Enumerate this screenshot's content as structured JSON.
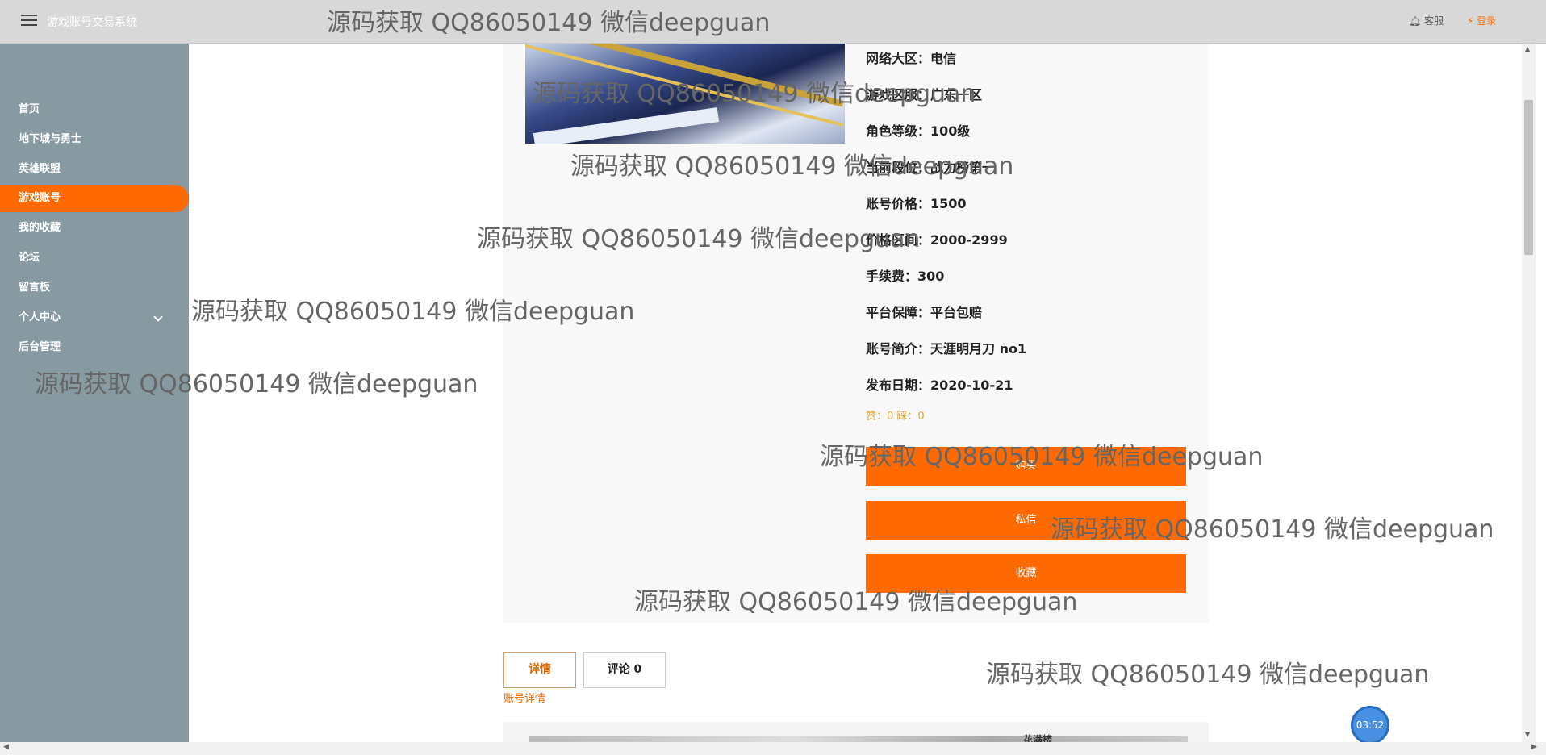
{
  "header": {
    "app_title": "游戏账号交易系统",
    "service_label": "客服",
    "login_label": "登录"
  },
  "sidebar": {
    "items": [
      {
        "label": "首页"
      },
      {
        "label": "地下城与勇士"
      },
      {
        "label": "英雄联盟"
      },
      {
        "label": "游戏账号",
        "active": true
      },
      {
        "label": "我的收藏"
      },
      {
        "label": "论坛"
      },
      {
        "label": "留言板"
      },
      {
        "label": "个人中心"
      },
      {
        "label": "后台管理"
      }
    ]
  },
  "account": {
    "fields": [
      {
        "text": "网络大区：电信"
      },
      {
        "text": "游戏区服：广东一区"
      },
      {
        "text": "角色等级：100级"
      },
      {
        "text": "当前段位：战力榜第一"
      },
      {
        "text": "账号价格：1500"
      },
      {
        "text": "价格区间：2000-2999"
      },
      {
        "text": "手续费：300"
      },
      {
        "text": "平台保障：平台包赔"
      },
      {
        "text": "账号简介：天涯明月刀 no1"
      },
      {
        "text": "发布日期：2020-10-21"
      }
    ],
    "likes": "赞：0 踩：0"
  },
  "actions": {
    "buy_label": "购买",
    "message_label": "私信",
    "favorite_label": "收藏"
  },
  "tabs": {
    "detail_label": "详情",
    "comment_label": "评论 0",
    "detail_section_label": "账号详情",
    "detail_heading": "花满楼"
  },
  "timer": "03:52",
  "watermark": "源码获取 QQ86050149 微信deepguan",
  "colors": {
    "accent": "#ff6a00",
    "sidebar": "#889aa1",
    "topbar": "#d8d8d8"
  }
}
